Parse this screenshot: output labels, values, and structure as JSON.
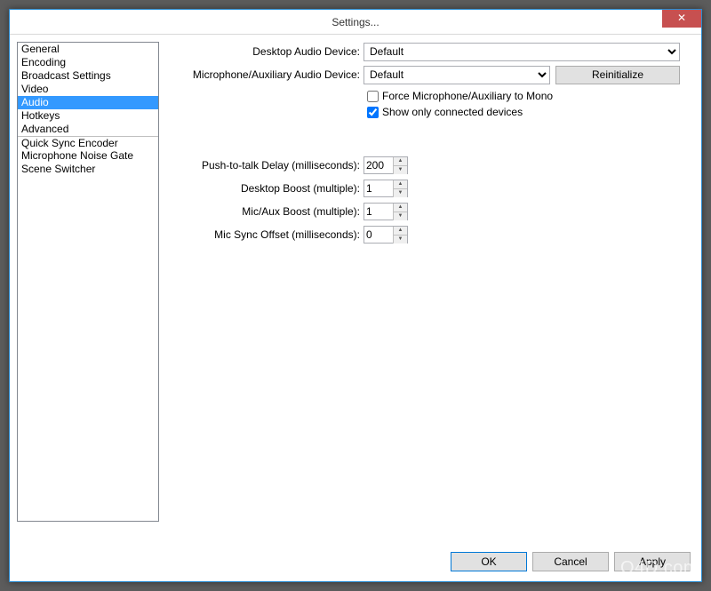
{
  "window": {
    "title": "Settings...",
    "close_glyph": "✕"
  },
  "sidebar": {
    "items": [
      {
        "label": "General"
      },
      {
        "label": "Encoding"
      },
      {
        "label": "Broadcast Settings"
      },
      {
        "label": "Video"
      },
      {
        "label": "Audio",
        "selected": true
      },
      {
        "label": "Hotkeys"
      },
      {
        "label": "Advanced"
      },
      {
        "label": "Quick Sync Encoder",
        "separator": true
      },
      {
        "label": "Microphone Noise Gate"
      },
      {
        "label": "Scene Switcher"
      }
    ]
  },
  "audio": {
    "desktop_audio_label": "Desktop Audio Device:",
    "desktop_audio_value": "Default",
    "mic_aux_label": "Microphone/Auxiliary Audio Device:",
    "mic_aux_value": "Default",
    "reinitialize_label": "Reinitialize",
    "force_mono_label": "Force Microphone/Auxiliary to Mono",
    "force_mono_checked": false,
    "show_connected_label": "Show only connected devices",
    "show_connected_checked": true,
    "ptt_delay_label": "Push-to-talk Delay (milliseconds):",
    "ptt_delay_value": "200",
    "desktop_boost_label": "Desktop Boost (multiple):",
    "desktop_boost_value": "1",
    "micaux_boost_label": "Mic/Aux Boost (multiple):",
    "micaux_boost_value": "1",
    "mic_sync_label": "Mic Sync Offset (milliseconds):",
    "mic_sync_value": "0"
  },
  "footer": {
    "ok": "OK",
    "cancel": "Cancel",
    "apply": "Apply"
  },
  "watermark": "LO4D.com"
}
